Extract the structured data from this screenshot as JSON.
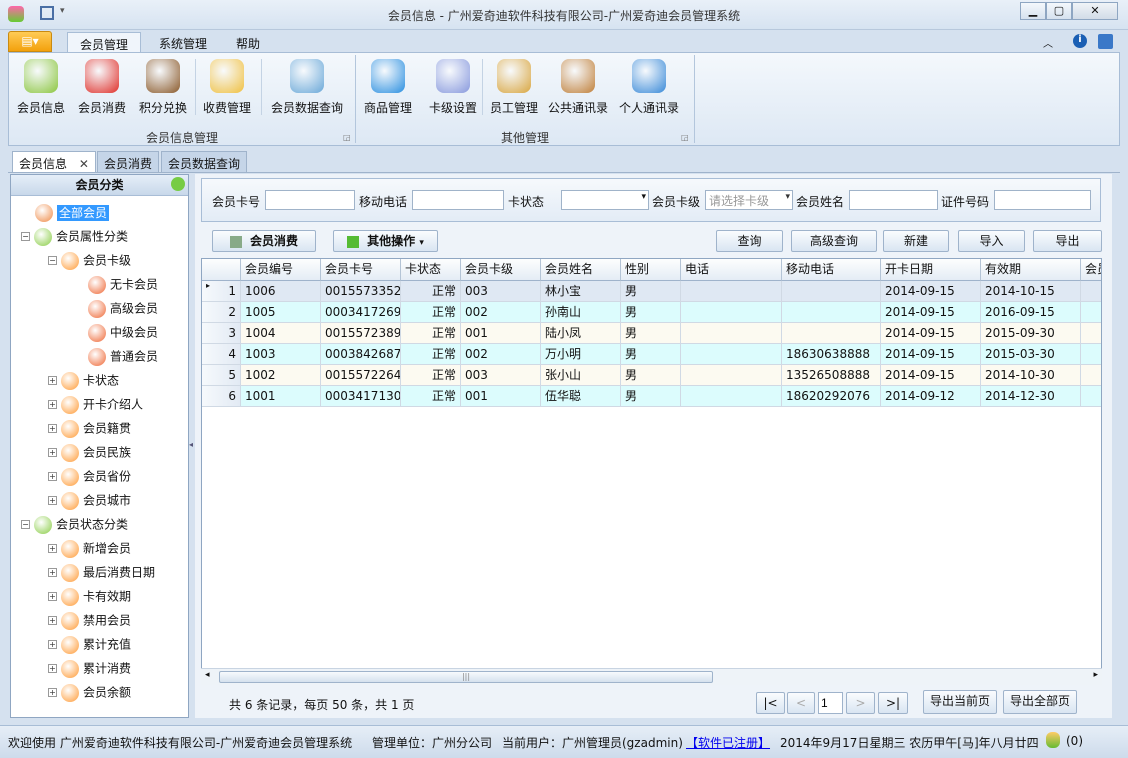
{
  "window": {
    "title": "会员信息 - 广州爱奇迪软件科技有限公司-广州爱奇迪会员管理系统",
    "minimize": "▁",
    "maximize": "▢",
    "close": "✕"
  },
  "ribbon_tabs": [
    "会员管理",
    "系统管理",
    "帮助"
  ],
  "ribbon": {
    "groups": [
      {
        "label": "会员信息管理"
      },
      {
        "label": "其他管理"
      }
    ],
    "buttons": [
      {
        "label": "会员信息",
        "icon": "members-icon",
        "color": "#8cc63f"
      },
      {
        "label": "会员消费",
        "icon": "basket-icon",
        "color": "#e0302a"
      },
      {
        "label": "积分兑换",
        "icon": "teddy-bear-icon",
        "color": "#8b5a2b"
      },
      {
        "label": "收费管理",
        "icon": "coins-add-icon",
        "color": "#f0c040"
      },
      {
        "label": "会员数据查询",
        "icon": "document-search-icon",
        "color": "#6aa8d8"
      },
      {
        "label": "商品管理",
        "icon": "shapes-icon",
        "color": "#2a8fe0"
      },
      {
        "label": "卡级设置",
        "icon": "id-card-icon",
        "color": "#8899dd"
      },
      {
        "label": "员工管理",
        "icon": "employee-icon",
        "color": "#d9a640"
      },
      {
        "label": "公共通讯录",
        "icon": "address-book-icon",
        "color": "#c0803a"
      },
      {
        "label": "个人通讯录",
        "icon": "notebook-key-icon",
        "color": "#3a8ad8"
      }
    ]
  },
  "doc_tabs": [
    {
      "label": "会员信息",
      "close": "✕"
    },
    {
      "label": "会员消费"
    },
    {
      "label": "会员数据查询"
    }
  ],
  "tree": {
    "title": "会员分类",
    "nodes": [
      {
        "label": "全部会员",
        "level": 0,
        "selected": true
      },
      {
        "label": "会员属性分类",
        "level": 0,
        "toggle": "−"
      },
      {
        "label": "会员卡级",
        "level": 1,
        "toggle": "−"
      },
      {
        "label": "无卡会员",
        "level": 2
      },
      {
        "label": "高级会员",
        "level": 2
      },
      {
        "label": "中级会员",
        "level": 2
      },
      {
        "label": "普通会员",
        "level": 2
      },
      {
        "label": "卡状态",
        "level": 1,
        "toggle": "+"
      },
      {
        "label": "开卡介绍人",
        "level": 1,
        "toggle": "+"
      },
      {
        "label": "会员籍贯",
        "level": 1,
        "toggle": "+"
      },
      {
        "label": "会员民族",
        "level": 1,
        "toggle": "+"
      },
      {
        "label": "会员省份",
        "level": 1,
        "toggle": "+"
      },
      {
        "label": "会员城市",
        "level": 1,
        "toggle": "+"
      },
      {
        "label": "会员状态分类",
        "level": 0,
        "toggle": "−"
      },
      {
        "label": "新增会员",
        "level": 1,
        "toggle": "+"
      },
      {
        "label": "最后消费日期",
        "level": 1,
        "toggle": "+"
      },
      {
        "label": "卡有效期",
        "level": 1,
        "toggle": "+"
      },
      {
        "label": "禁用会员",
        "level": 1,
        "toggle": "+"
      },
      {
        "label": "累计充值",
        "level": 1,
        "toggle": "+"
      },
      {
        "label": "累计消费",
        "level": 1,
        "toggle": "+"
      },
      {
        "label": "会员余额",
        "level": 1,
        "toggle": "+"
      }
    ]
  },
  "search": {
    "card_no": "会员卡号",
    "mobile": "移动电话",
    "card_status": "卡状态",
    "card_level": "会员卡级",
    "card_level_placeholder": "请选择卡级",
    "name": "会员姓名",
    "id_no": "证件号码"
  },
  "toolbar": {
    "consume": "会员消费",
    "other": "其他操作",
    "query": "查询",
    "advanced": "高级查询",
    "new": "新建",
    "import": "导入",
    "export": "导出"
  },
  "table": {
    "columns": [
      "会员编号",
      "会员卡号",
      "卡状态",
      "会员卡级",
      "会员姓名",
      "性别",
      "电话",
      "移动电话",
      "开卡日期",
      "有效期",
      "会员"
    ],
    "rows": [
      [
        "1",
        "1006",
        "0015573352",
        "正常",
        "003",
        "林小宝",
        "男",
        "",
        "",
        "2014-09-15",
        "2014-10-15",
        ""
      ],
      [
        "2",
        "1005",
        "0003417269",
        "正常",
        "002",
        "孙南山",
        "男",
        "",
        "",
        "2014-09-15",
        "2016-09-15",
        ""
      ],
      [
        "3",
        "1004",
        "0015572389",
        "正常",
        "001",
        "陆小凤",
        "男",
        "",
        "",
        "2014-09-15",
        "2015-09-30",
        ""
      ],
      [
        "4",
        "1003",
        "0003842687",
        "正常",
        "002",
        "万小明",
        "男",
        "",
        "18630638888",
        "2014-09-15",
        "2015-03-30",
        ""
      ],
      [
        "5",
        "1002",
        "0015572264",
        "正常",
        "003",
        "张小山",
        "男",
        "",
        "13526508888",
        "2014-09-15",
        "2014-10-30",
        ""
      ],
      [
        "6",
        "1001",
        "0003417130",
        "正常",
        "001",
        "伍华聪",
        "男",
        "",
        "18620292076",
        "2014-09-12",
        "2014-12-30",
        ""
      ]
    ],
    "selected_row": 0
  },
  "pager": {
    "summary": "共 6 条记录，每页 50 条，共 1 页",
    "first": "|<",
    "prev": "<",
    "page": "1",
    "next": ">",
    "last": ">|",
    "export_current": "导出当前页",
    "export_all": "导出全部页"
  },
  "status": {
    "welcome": "欢迎使用 广州爱奇迪软件科技有限公司-广州爱奇迪会员管理系统",
    "unit": "管理单位：广州分公司",
    "user": "当前用户：广州管理员(gzadmin)",
    "registered": "【软件已注册】",
    "date": "2014年9月17日星期三 农历甲午[马]年八月廿四",
    "online": "(0)"
  }
}
